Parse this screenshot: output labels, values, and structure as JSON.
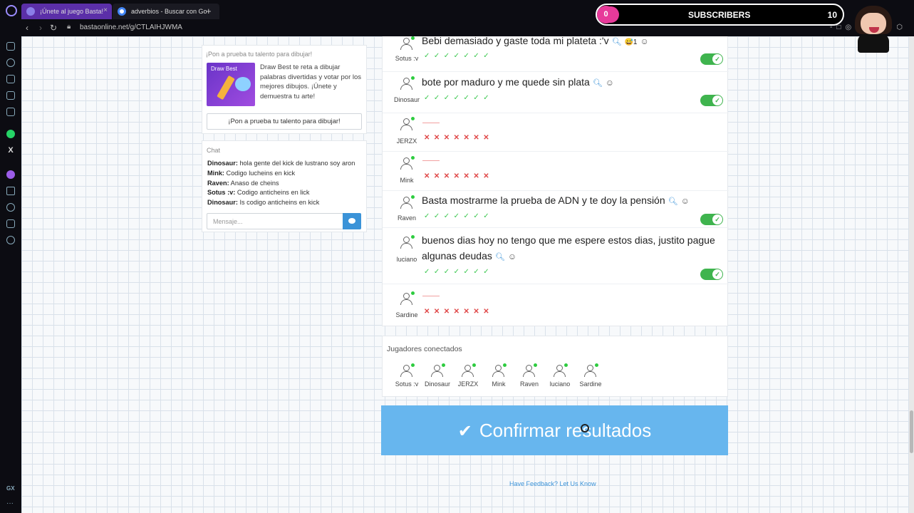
{
  "browser": {
    "tabs": [
      {
        "label": "¡Únete al juego Basta!"
      },
      {
        "label": "adverbios - Buscar con Go"
      }
    ],
    "url": "bastaonline.net/g/CTLAIHJWMA"
  },
  "overlay": {
    "subscribers_label": "SUBSCRIBERS",
    "subscribers_count": "10",
    "progress_value": "0"
  },
  "promo": {
    "title": "¡Pon a prueba tu talento para dibujar!",
    "image_label": "Draw Best",
    "text": "Draw Best te reta a dibujar palabras divertidas y votar por los mejores dibujos. ¡Únete y demuestra tu arte!",
    "button_label": "¡Pon a prueba tu talento para dibujar!"
  },
  "chat": {
    "title": "Chat",
    "messages": [
      {
        "user": "Dinosaur:",
        "text": " hola gente del kick de lustrano soy aron"
      },
      {
        "user": "Mink:",
        "text": " Codigo lucheins en kick"
      },
      {
        "user": "Raven:",
        "text": " Anaso de cheins"
      },
      {
        "user": "Sotus :v:",
        "text": " Codigo anticheins en lick"
      },
      {
        "user": "Dinosaur:",
        "text": " Is codigo anticheins en kick"
      }
    ],
    "input_placeholder": "Mensaje..."
  },
  "results": {
    "rows": [
      {
        "user": "Sotus :v",
        "answer": "Bebi demasiado y gaste toda mi plateta :'v",
        "reaction": "😅1",
        "valid": true,
        "marks": "✓✓✓✓✓✓✓"
      },
      {
        "user": "Dinosaur",
        "answer": "bote por maduro y me quede sin plata",
        "valid": true,
        "marks": "✓✓✓✓✓✓✓"
      },
      {
        "user": "JERZX",
        "answer": "",
        "valid": false,
        "marks": "✕✕✕✕✕✕✕"
      },
      {
        "user": "Mink",
        "answer": "",
        "valid": false,
        "marks": "✕✕✕✕✕✕✕"
      },
      {
        "user": "Raven",
        "answer": "Basta mostrarme la prueba de ADN y te doy la pensión",
        "valid": true,
        "marks": "✓✓✓✓✓✓✓"
      },
      {
        "user": "luciano",
        "answer_line1": "buenos dias hoy no tengo que me espere estos dias, justito pague",
        "answer_line2": "algunas deudas",
        "valid": true,
        "marks": "✓✓✓✓✓✓✓"
      },
      {
        "user": "Sardine",
        "answer": "",
        "valid": false,
        "marks": "✕✕✕✕✕✕✕"
      }
    ]
  },
  "players": {
    "title": "Jugadores conectados",
    "list": [
      "Sotus :v",
      "Dinosaur",
      "JERZX",
      "Mink",
      "Raven",
      "luciano",
      "Sardine"
    ]
  },
  "confirm_label": "Confirmar resultados",
  "feedback_label": "Have Feedback? Let Us Know",
  "icons": {
    "search": "magnifier-icon",
    "react": "smiley-icon",
    "check": "check-icon",
    "cross": "cross-icon",
    "send": "chat-bubble-icon"
  },
  "colors": {
    "accent": "#3b93d8",
    "confirm": "#67b6ee",
    "valid": "#3fb44e",
    "invalid": "#e04848",
    "overlay_pink": "#e73a9a"
  }
}
